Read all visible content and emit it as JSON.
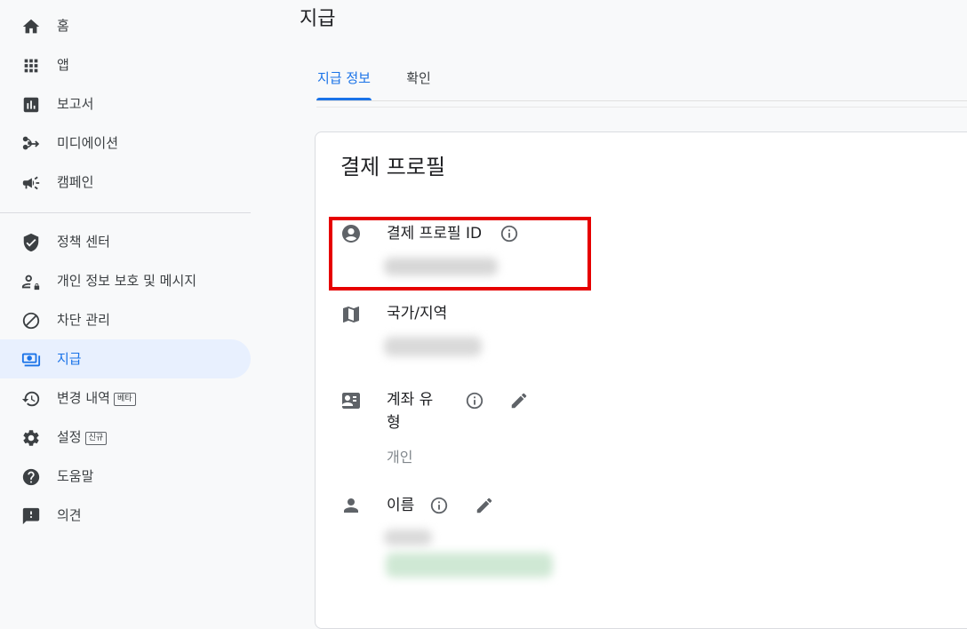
{
  "sidebar": {
    "items": [
      {
        "label": "홈",
        "icon": "home-icon"
      },
      {
        "label": "앱",
        "icon": "apps-grid-icon"
      },
      {
        "label": "보고서",
        "icon": "bar-chart-icon"
      },
      {
        "label": "미디에이션",
        "icon": "mediation-icon"
      },
      {
        "label": "캠페인",
        "icon": "megaphone-icon"
      },
      {
        "label": "정책 센터",
        "icon": "shield-check-icon"
      },
      {
        "label": "개인 정보 보호 및 메시지",
        "icon": "person-lock-icon"
      },
      {
        "label": "차단 관리",
        "icon": "block-icon"
      },
      {
        "label": "지급",
        "icon": "payments-icon",
        "active": true
      },
      {
        "label": "변경 내역",
        "icon": "history-icon",
        "badge": "베타"
      },
      {
        "label": "설정",
        "icon": "gear-icon",
        "badge": "신규"
      },
      {
        "label": "도움말",
        "icon": "help-icon"
      },
      {
        "label": "의견",
        "icon": "feedback-icon"
      }
    ]
  },
  "main": {
    "title": "지급",
    "tabs": [
      {
        "label": "지급 정보",
        "active": true
      },
      {
        "label": "확인"
      }
    ],
    "card": {
      "title": "결제 프로필",
      "fields": {
        "profile_id": {
          "label": "결제 프로필 ID",
          "icon": "account-circle-icon"
        },
        "country": {
          "label": "국가/지역",
          "icon": "map-icon"
        },
        "account_type": {
          "label_line1": "계좌 유",
          "label_line2": "형",
          "value": "개인",
          "icon": "contact-card-icon"
        },
        "name": {
          "label": "이름",
          "icon": "person-icon"
        }
      }
    }
  },
  "colors": {
    "accent": "#1a73e8",
    "active_bg": "#e8f0fe",
    "highlight": "#e60000",
    "text": "#202124",
    "icon": "#5f6368"
  }
}
